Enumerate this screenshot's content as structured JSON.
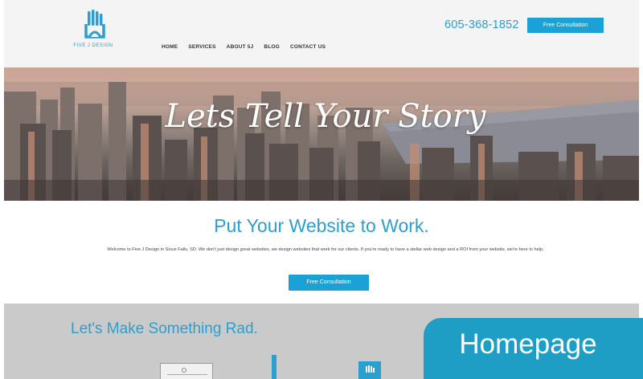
{
  "header": {
    "logo_text": "FIVE J DESIGN",
    "phone": "605-368-1852",
    "cta_label": "Free Consultation",
    "nav": [
      "HOME",
      "SERVICES",
      "ABOUT 5J",
      "BLOG",
      "CONTACT US"
    ]
  },
  "hero": {
    "title": "Lets Tell Your Story"
  },
  "intro": {
    "title": "Put Your Website to Work.",
    "text": "Welcome to Five J Design in Sioux Falls, SD. We don't just design great websites, we design websites that work for our clients. If you're ready to have a stellar web design and a ROI from your website, we're here to help.",
    "cta_label": "Free Consultation"
  },
  "rad": {
    "title": "Let's Make Something Rad."
  },
  "badge": {
    "label": "Homepage"
  },
  "colors": {
    "accent": "#1aa2d6",
    "brand_text": "#2a9fd0",
    "badge": "#1e9ec4"
  },
  "icons": [
    "hand-logo-icon",
    "browser-window-icon",
    "pencil-icon",
    "hand-card-icon"
  ]
}
